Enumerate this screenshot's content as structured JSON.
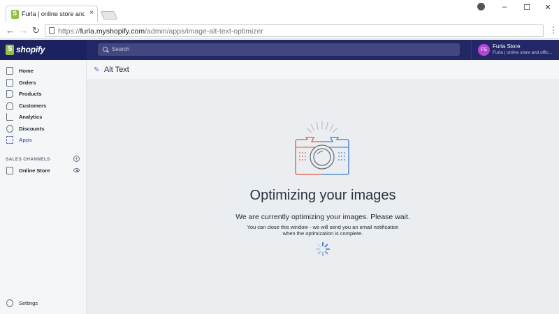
{
  "browser": {
    "tab_title": "Furla | online store and c",
    "tab_close": "×",
    "url_prefix": "https://",
    "url_host": "furla.myshopify.com",
    "url_path": "/admin/apps/image-alt-text-optimizer",
    "window_controls": [
      "–",
      "☐",
      "✕"
    ]
  },
  "topbar": {
    "logo_text": "shopify",
    "search_placeholder": "Search",
    "account": {
      "initials": "FS",
      "name": "Furla Store",
      "subtitle": "Furla | online store and offic..."
    }
  },
  "sidebar": {
    "items": [
      {
        "label": "Home",
        "icon": "home-icon"
      },
      {
        "label": "Orders",
        "icon": "orders-icon"
      },
      {
        "label": "Products",
        "icon": "tag-icon"
      },
      {
        "label": "Customers",
        "icon": "person-icon"
      },
      {
        "label": "Analytics",
        "icon": "bar-chart-icon"
      },
      {
        "label": "Discounts",
        "icon": "discount-icon"
      },
      {
        "label": "Apps",
        "icon": "apps-icon",
        "active": true
      }
    ],
    "sales_channels_heading": "SALES CHANNELS",
    "online_store": "Online Store",
    "settings": "Settings"
  },
  "main": {
    "page_title": "Alt Text",
    "heading": "Optimizing your images",
    "message": "We are currently optimizing your images. Please wait.",
    "note_line1": "You can close this window - we will send you an email notification",
    "note_line2": "when the optimization is complete."
  },
  "colors": {
    "topbar": "#1c2260",
    "accent": "#5c6ac4",
    "shopify_green": "#95bf47",
    "camera_red": "#e0584b",
    "camera_blue": "#3a7bd5"
  }
}
